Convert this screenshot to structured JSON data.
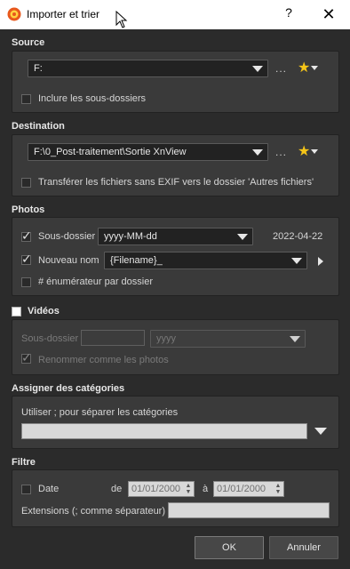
{
  "window": {
    "title": "Importer et trier",
    "help": "?",
    "close": "✕"
  },
  "source": {
    "heading": "Source",
    "path": "F:",
    "browse": "...",
    "include_subfolders_label": "Inclure les sous-dossiers",
    "include_subfolders": false
  },
  "destination": {
    "heading": "Destination",
    "path": "F:\\0_Post-traitement\\Sortie XnView",
    "browse": "...",
    "no_exif_label": "Transférer les fichiers sans EXIF vers le dossier 'Autres fichiers'",
    "no_exif": false
  },
  "photos": {
    "heading": "Photos",
    "subfolder_label": "Sous-dossier",
    "subfolder_checked": true,
    "subfolder_format": "yyyy-MM-dd",
    "subfolder_preview": "2022-04-22",
    "rename_label": "Nouveau nom",
    "rename_checked": true,
    "rename_pattern": "{Filename}_",
    "counter_label": "# énumérateur par dossier",
    "counter_checked": false
  },
  "videos": {
    "heading": "Vidéos",
    "enabled": false,
    "subfolder_label": "Sous-dossier",
    "subfolder_format": "yyyy",
    "rename_like_photos_label": "Renommer comme les photos",
    "rename_like_photos": true
  },
  "categories": {
    "heading": "Assigner des catégories",
    "hint": "Utiliser ; pour séparer les catégories",
    "value": ""
  },
  "filter": {
    "heading": "Filtre",
    "date_label": "Date",
    "date_checked": false,
    "from_label": "de",
    "from_date": "01/01/2000",
    "to_label": "à",
    "to_date": "01/01/2000",
    "extensions_label": "Extensions (; comme séparateur)",
    "extensions_value": ""
  },
  "buttons": {
    "ok": "OK",
    "cancel": "Annuler"
  }
}
